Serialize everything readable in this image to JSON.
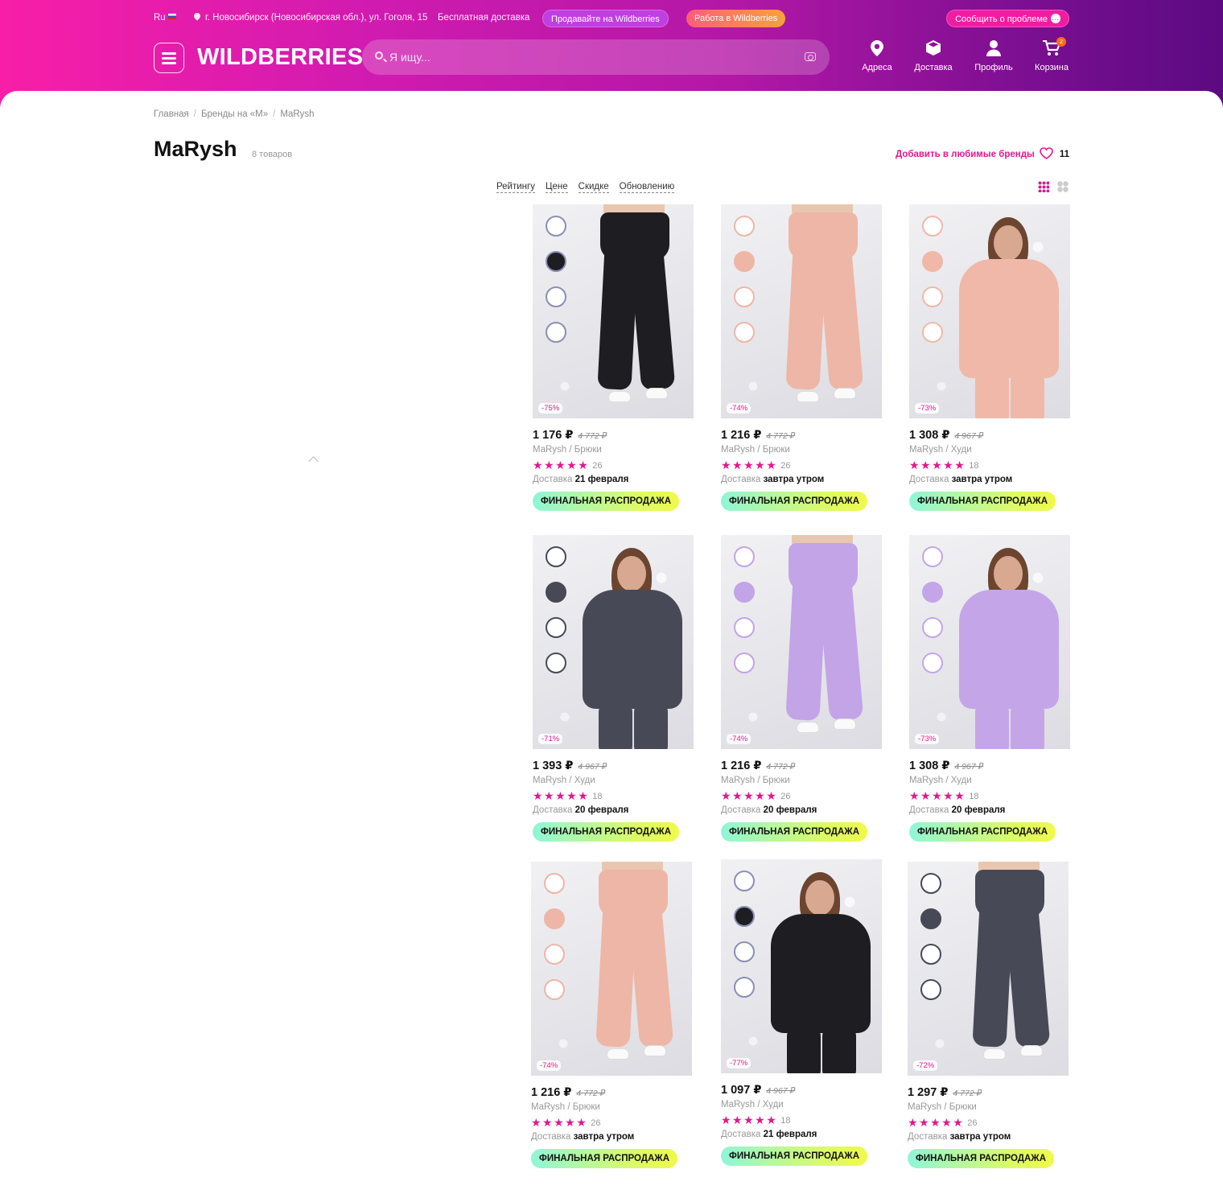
{
  "header": {
    "lang": "Ru",
    "location": "г. Новосибирск (Новосибирская обл.), ул. Гоголя, 15",
    "free_delivery": "Бесплатная доставка",
    "sell_pill": "Продавайте на Wildberries",
    "work_pill": "Работа в Wildberries",
    "report_pill": "Сообщить о проблеме",
    "logo": "WILDBERRIES",
    "search_placeholder": "Я ищу...",
    "nav": {
      "addresses": "Адреса",
      "delivery": "Доставка",
      "profile": "Профиль",
      "cart": "Корзина",
      "cart_count": "2"
    }
  },
  "breadcrumb": [
    "Главная",
    "Бренды на «М»",
    "MaRysh"
  ],
  "title": "MaRysh",
  "count": "8 товаров",
  "favorite": {
    "label": "Добавить в любимые бренды",
    "count": "11"
  },
  "sort": [
    "Рейтингу",
    "Цене",
    "Скидке",
    "Обновлению"
  ],
  "colors": {
    "accent": "#e5168e",
    "header_start": "#f81ea8",
    "header_end": "#5c0a82"
  },
  "products": [
    {
      "price": "1 176 ₽",
      "old": "4 772 ₽",
      "brand": "MaRysh / Брюки",
      "rating_count": "26",
      "delivery_label": "Доставка",
      "delivery": "21 февраля",
      "discount": "-75%",
      "sale": "ФИНАЛЬНАЯ РАСПРОДАЖА",
      "stars": "★★★★★"
    },
    {
      "price": "1 216 ₽",
      "old": "4 772 ₽",
      "brand": "MaRysh / Брюки",
      "rating_count": "26",
      "delivery_label": "Доставка",
      "delivery": "завтра утром",
      "discount": "-74%",
      "sale": "ФИНАЛЬНАЯ РАСПРОДАЖА",
      "stars": "★★★★★"
    },
    {
      "price": "1 308 ₽",
      "old": "4 967 ₽",
      "brand": "MaRysh / Худи",
      "rating_count": "18",
      "delivery_label": "Доставка",
      "delivery": "завтра утром",
      "discount": "-73%",
      "sale": "ФИНАЛЬНАЯ РАСПРОДАЖА",
      "stars": "★★★★★"
    },
    {
      "price": "1 393 ₽",
      "old": "4 967 ₽",
      "brand": "MaRysh / Худи",
      "rating_count": "18",
      "delivery_label": "Доставка",
      "delivery": "20 февраля",
      "discount": "-71%",
      "sale": "ФИНАЛЬНАЯ РАСПРОДАЖА",
      "stars": "★★★★★"
    },
    {
      "price": "1 216 ₽",
      "old": "4 772 ₽",
      "brand": "MaRysh / Брюки",
      "rating_count": "26",
      "delivery_label": "Доставка",
      "delivery": "20 февраля",
      "discount": "-74%",
      "sale": "ФИНАЛЬНАЯ РАСПРОДАЖА",
      "stars": "★★★★★"
    },
    {
      "price": "1 308 ₽",
      "old": "4 967 ₽",
      "brand": "MaRysh / Худи",
      "rating_count": "18",
      "delivery_label": "Доставка",
      "delivery": "20 февраля",
      "discount": "-73%",
      "sale": "ФИНАЛЬНАЯ РАСПРОДАЖА",
      "stars": "★★★★★"
    },
    {
      "price": "1 216 ₽",
      "old": "4 772 ₽",
      "brand": "MaRysh / Брюки",
      "rating_count": "26",
      "delivery_label": "Доставка",
      "delivery": "завтра утром",
      "discount": "-74%",
      "sale": "ФИНАЛЬНАЯ РАСПРОДАЖА",
      "stars": "★★★★★"
    },
    {
      "price": "1 097 ₽",
      "old": "4 967 ₽",
      "brand": "MaRysh / Худи",
      "rating_count": "18",
      "delivery_label": "Доставка",
      "delivery": "21 февраля",
      "discount": "-77%",
      "sale": "ФИНАЛЬНАЯ РАСПРОДАЖА",
      "stars": "★★★★★"
    },
    {
      "price": "1 297 ₽",
      "old": "4 772 ₽",
      "brand": "MaRysh / Брюки",
      "rating_count": "26",
      "delivery_label": "Доставка",
      "delivery": "завтра утром",
      "discount": "-72%",
      "sale": "ФИНАЛЬНАЯ РАСПРОДАЖА",
      "stars": "★★★★★"
    }
  ]
}
